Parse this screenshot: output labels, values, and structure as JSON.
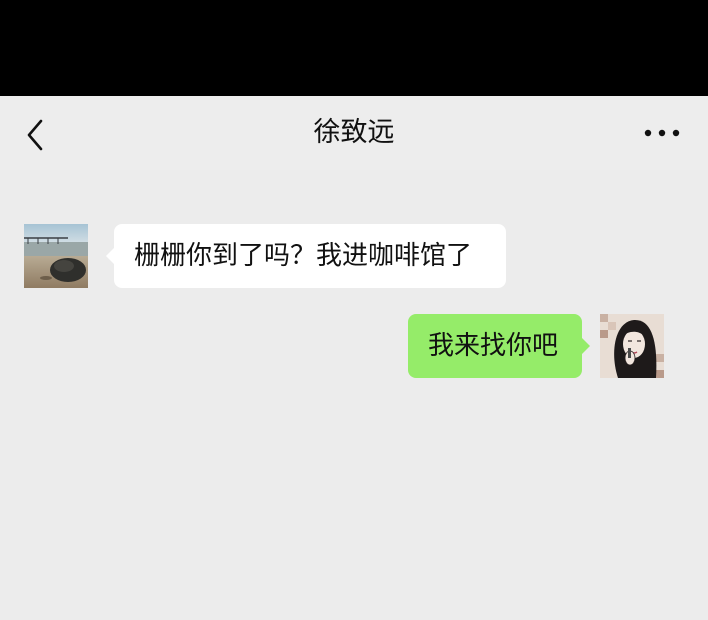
{
  "header": {
    "title": "徐致远",
    "back_icon": "chevron-left-icon",
    "more_icon": "more-dots-icon"
  },
  "messages": [
    {
      "direction": "incoming",
      "text": "栅栅你到了吗？我进咖啡馆了",
      "avatar": "seaside-rock-photo"
    },
    {
      "direction": "outgoing",
      "text": "我来找你吧",
      "avatar": "girl-portrait-illustration"
    }
  ],
  "colors": {
    "status_bar": "#000000",
    "background": "#ededed",
    "incoming_bubble": "#ffffff",
    "outgoing_bubble": "#95ec69"
  }
}
